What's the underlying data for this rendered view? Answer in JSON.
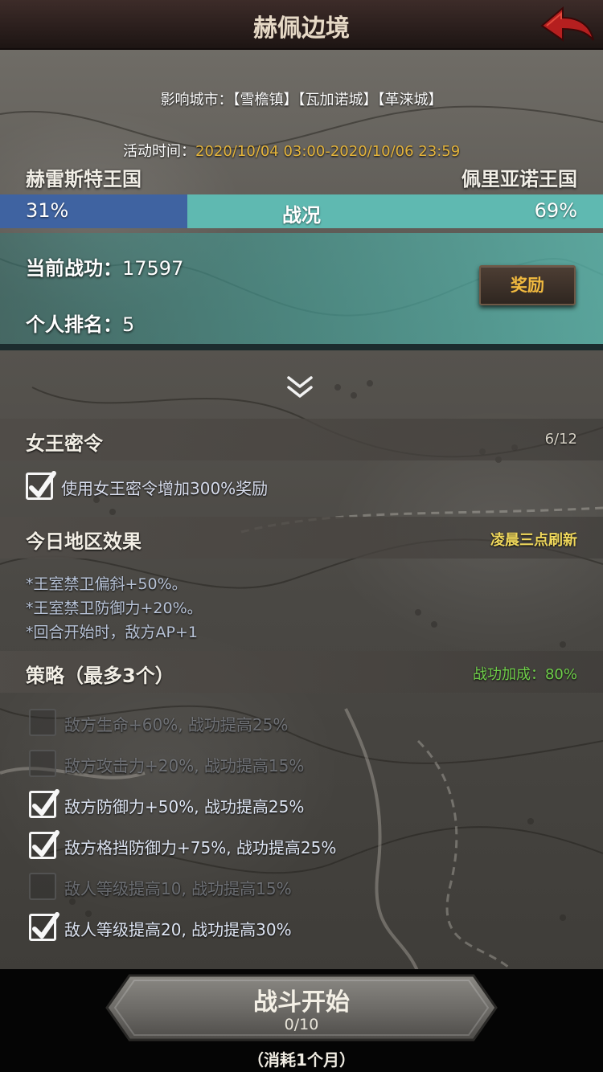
{
  "header": {
    "title": "赫佩边境"
  },
  "info": {
    "cities_label": "影响城市：",
    "cities": "【雪檐镇】【瓦加诺城】【革涞城】",
    "time_label": "活动时间：",
    "time_value": "2020/10/04 03:00-2020/10/06 23:59"
  },
  "kingdoms": {
    "left": "赫雷斯特王国",
    "right": "佩里亚诺王国"
  },
  "war_bar": {
    "left_pct": "31%",
    "center": "战况",
    "right_pct": "69%",
    "left_fraction": 0.31,
    "left_color": "#3f63a1",
    "right_color": "#5fb9b1"
  },
  "score": {
    "merit_label": "当前战功：",
    "merit_value": "17597",
    "rank_label": "个人排名：",
    "rank_value": "5",
    "reward_button": "奖励"
  },
  "queen_order": {
    "title": "女王密令",
    "count": "6/12",
    "checkbox_label": "使用女王密令增加300%奖励",
    "checked": true
  },
  "region": {
    "title": "今日地区效果",
    "refresh": "凌晨三点刷新",
    "effects": [
      "*王室禁卫偏斜+50%。",
      "*王室禁卫防御力+20%。",
      "*回合开始时，敌方AP+1"
    ]
  },
  "strategy": {
    "title": "策略（最多3个）",
    "bonus": "战功加成：80%",
    "items": [
      {
        "label": "敌方生命+60%, 战功提高25%",
        "checked": false
      },
      {
        "label": "敌方攻击力+20%, 战功提高15%",
        "checked": false
      },
      {
        "label": "敌方防御力+50%, 战功提高25%",
        "checked": true
      },
      {
        "label": "敌方格挡防御力+75%, 战功提高25%",
        "checked": true
      },
      {
        "label": "敌人等级提高10, 战功提高15%",
        "checked": false
      },
      {
        "label": "敌人等级提高20, 战功提高30%",
        "checked": true
      }
    ]
  },
  "battle": {
    "title": "战斗开始",
    "count": "0/10",
    "cost": "（消耗1个月）"
  },
  "icons": {
    "back": "back-arrow-icon",
    "expand": "double-chevron-down-icon",
    "check": "checkmark-icon"
  }
}
